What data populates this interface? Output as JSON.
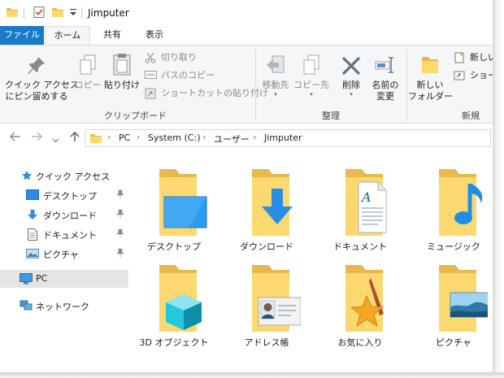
{
  "window": {
    "title": "Jimputer"
  },
  "ribbon_tabs": [
    {
      "label": "ファイル"
    },
    {
      "label": "ホーム"
    },
    {
      "label": "共有"
    },
    {
      "label": "表示"
    }
  ],
  "ribbon": {
    "clipboard": {
      "pin_label_1": "クイック アクセス",
      "pin_label_2": "にピン留めする",
      "copy_label": "コピー",
      "paste_label": "貼り付け",
      "cut_label": "切り取り",
      "copy_path_label": "パスのコピー",
      "paste_shortcut_label": "ショートカットの貼り付け",
      "group_label": "クリップボード"
    },
    "organize": {
      "move_to_label": "移動先",
      "copy_to_label": "コピー先",
      "delete_label": "削除",
      "rename_label_1": "名前の",
      "rename_label_2": "変更",
      "group_label": "整理"
    },
    "new": {
      "new_folder_label_1": "新しい",
      "new_folder_label_2": "フォルダー",
      "new_item_label": "新しいア",
      "shortcut_label": "ショートカ",
      "group_label": "新規"
    }
  },
  "address": {
    "crumbs": [
      "PC",
      "System (C:)",
      "ユーザー",
      "Jimputer"
    ]
  },
  "nav_pane": {
    "quick_access": "クイック アクセス",
    "items": [
      {
        "label": "デスクトップ"
      },
      {
        "label": "ダウンロード"
      },
      {
        "label": "ドキュメント"
      },
      {
        "label": "ピクチャ"
      }
    ],
    "pc": "PC",
    "network": "ネットワーク"
  },
  "folders": [
    {
      "label": "デスクトップ"
    },
    {
      "label": "ダウンロード"
    },
    {
      "label": "ドキュメント"
    },
    {
      "label": "ミュージック"
    },
    {
      "label": "3D オブジェクト"
    },
    {
      "label": "アドレス帳"
    },
    {
      "label": "お気に入り"
    },
    {
      "label": "ピクチャ"
    }
  ],
  "colors": {
    "file_tab": "#1979ca",
    "folder_back": "#e8b94a",
    "folder_front": "#fcd870",
    "accent_blue": "#2b8de6"
  }
}
